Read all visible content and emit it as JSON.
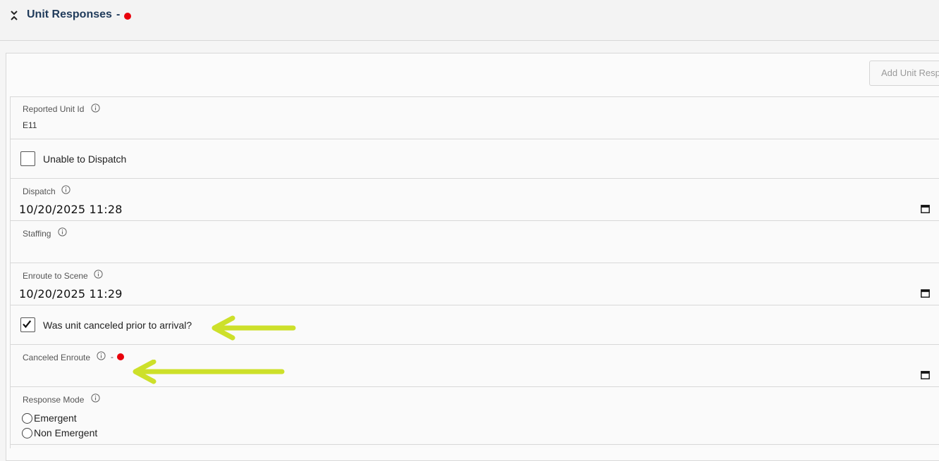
{
  "header": {
    "title": "Unit Responses",
    "separator": "-",
    "required_color": "#e8000b"
  },
  "toolbar": {
    "add_button_label": "Add Unit Resp"
  },
  "fields": {
    "reported_unit_id": {
      "label": "Reported Unit Id",
      "value": "E11"
    },
    "unable_to_dispatch": {
      "label": "Unable to Dispatch",
      "checked": false
    },
    "dispatch": {
      "label": "Dispatch",
      "value": "10/20/2025 11:28"
    },
    "staffing": {
      "label": "Staffing",
      "value": ""
    },
    "enroute_to_scene": {
      "label": "Enroute to Scene",
      "value": "10/20/2025 11:29"
    },
    "canceled_prior": {
      "label": "Was unit canceled prior to arrival?",
      "checked": true
    },
    "canceled_enroute": {
      "label": "Canceled Enroute",
      "separator": "-",
      "value": ""
    },
    "response_mode": {
      "label": "Response Mode",
      "options": [
        "Emergent",
        "Non Emergent"
      ]
    }
  },
  "annotations": {
    "arrow_color": "#cde02a"
  }
}
